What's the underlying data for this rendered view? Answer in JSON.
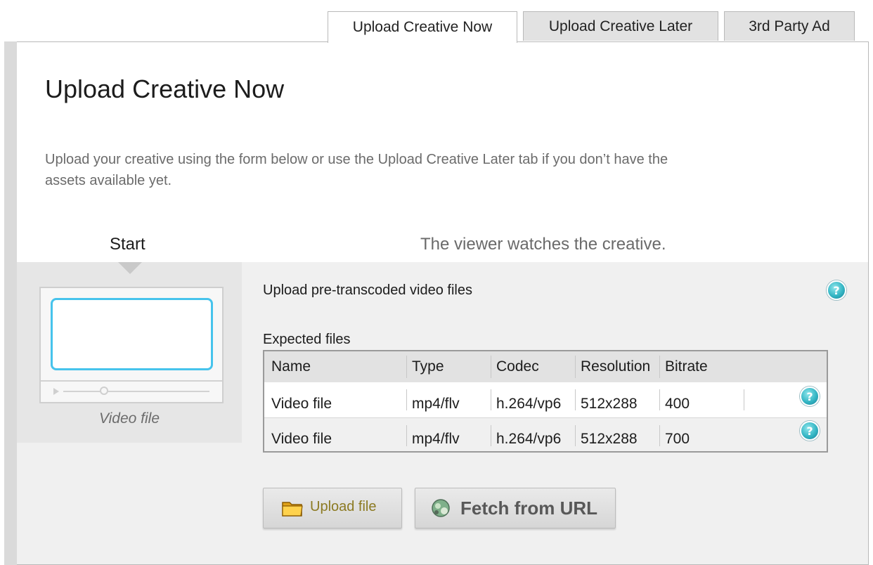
{
  "tabs": [
    {
      "label": "Upload Creative Now",
      "active": true
    },
    {
      "label": "Upload Creative Later",
      "active": false
    },
    {
      "label": "3rd Party Ad",
      "active": false
    }
  ],
  "page": {
    "title": "Upload Creative Now",
    "intro": "Upload your creative using the form below or use the Upload Creative Later tab if you don’t have the assets available yet."
  },
  "flow": {
    "step_label": "Start",
    "step_description": "The viewer watches the creative.",
    "preview_caption": "Video file"
  },
  "upload": {
    "heading": "Upload pre-transcoded video files",
    "expected_label": "Expected files",
    "columns": [
      "Name",
      "Type",
      "Codec",
      "Resolution",
      "Bitrate"
    ],
    "rows": [
      {
        "name": "Video file",
        "type": "mp4/flv",
        "codec": "h.264/vp6",
        "resolution": "512x288",
        "bitrate": "400"
      },
      {
        "name": "Video file",
        "type": "mp4/flv",
        "codec": "h.264/vp6",
        "resolution": "512x288",
        "bitrate": "700"
      }
    ],
    "help_glyph": "?"
  },
  "buttons": {
    "upload_file": "Upload file",
    "fetch_url": "Fetch from URL"
  },
  "icons": {
    "help": "help-icon",
    "folder": "folder-icon",
    "globe": "globe-icon"
  },
  "colors": {
    "accent_screen": "#46c3ec",
    "help_icon": "#35b6c4",
    "upload_label": "#8c7a22"
  }
}
